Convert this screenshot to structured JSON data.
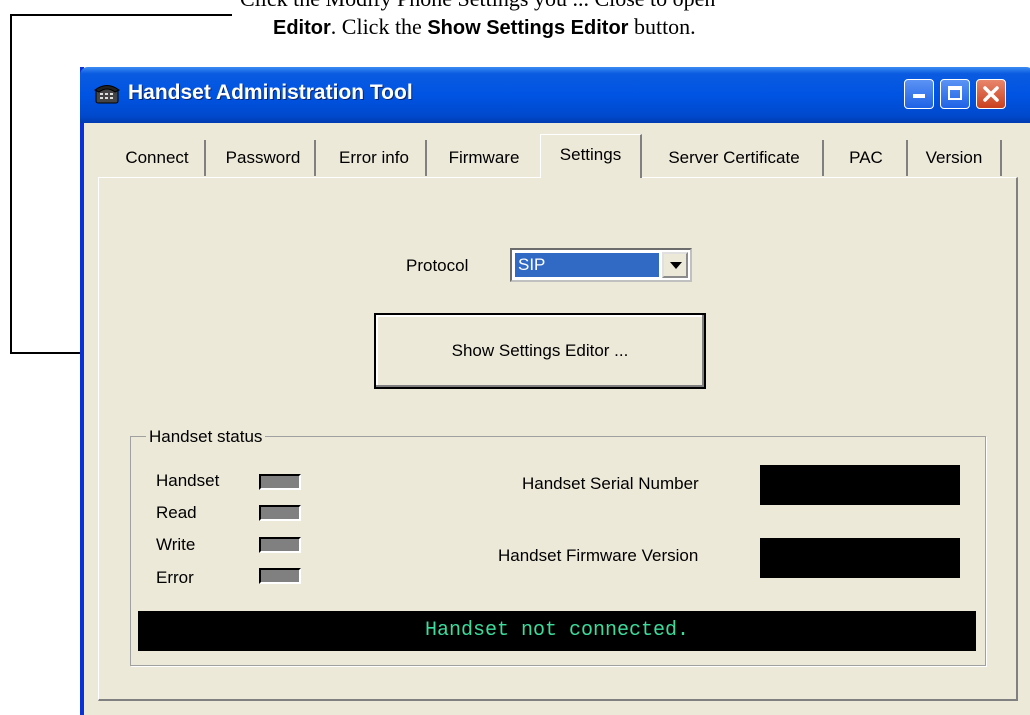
{
  "doc": {
    "top_line": "Click the Modify Phone Settings you ... Close to open",
    "line2_bold1": "Editor",
    "line2_mid": ". Click the ",
    "line2_bold2": "Show Settings Editor",
    "line2_end": " button."
  },
  "window": {
    "title": "Handset Administration Tool",
    "buttons": {
      "minimize": "_",
      "maximize": "□",
      "close": "✕"
    }
  },
  "tabs": [
    {
      "label": "Connect"
    },
    {
      "label": "Password"
    },
    {
      "label": "Error info"
    },
    {
      "label": "Firmware"
    },
    {
      "label": "Settings",
      "active": true
    },
    {
      "label": "Server Certificate"
    },
    {
      "label": "PAC"
    },
    {
      "label": "Version"
    }
  ],
  "protocol": {
    "label": "Protocol",
    "value": "SIP"
  },
  "show_settings_button": "Show Settings Editor ...",
  "status_group": {
    "title": "Handset status",
    "indicators": [
      "Handset",
      "Read",
      "Write",
      "Error"
    ],
    "serial_label": "Handset Serial Number",
    "firmware_label": "Handset Firmware Version",
    "serial_value": "",
    "firmware_value": ""
  },
  "status_message": "Handset not connected.",
  "colors": {
    "titlebar": "#0054e3",
    "window_bg": "#ece9d8",
    "selection": "#316ac5",
    "status_text": "#3cdc9c"
  }
}
